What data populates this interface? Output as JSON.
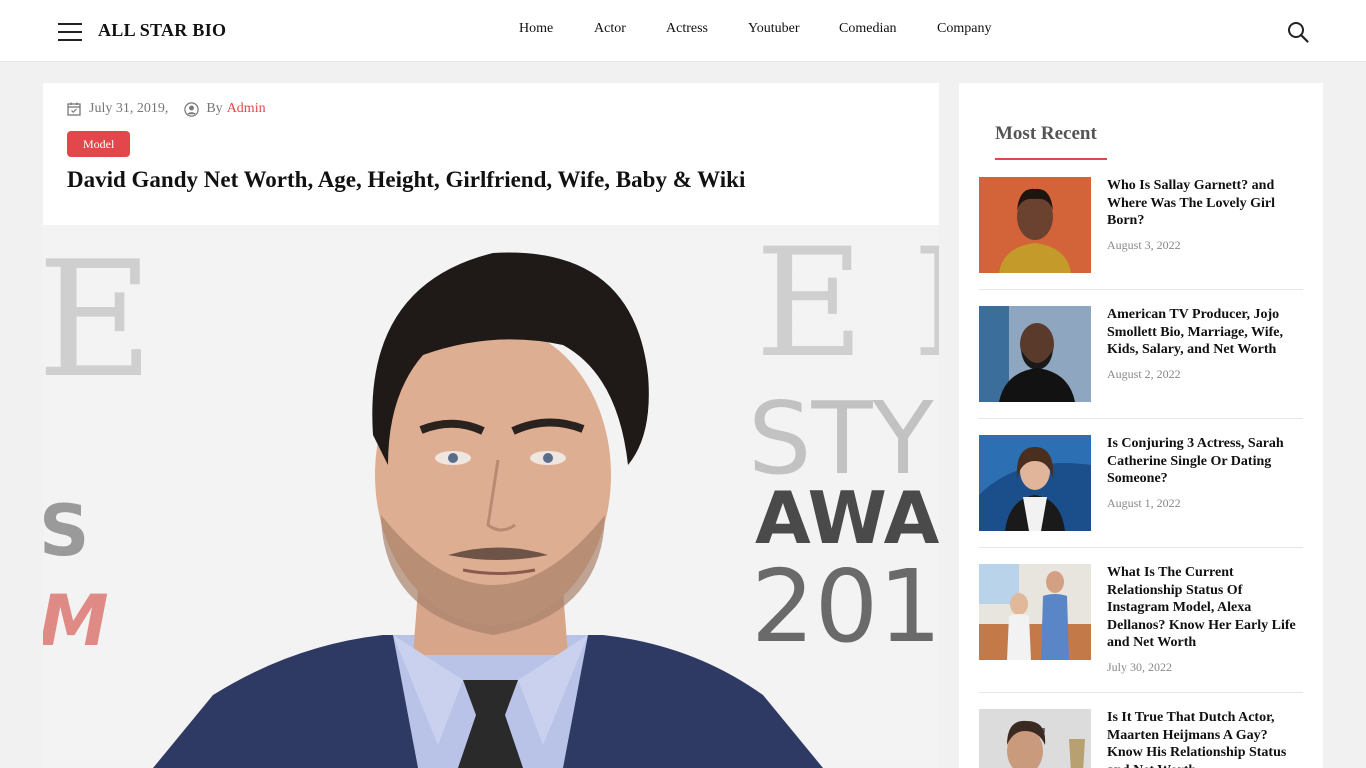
{
  "site": {
    "logo": "ALL STAR BIO"
  },
  "nav": [
    {
      "label": "Home"
    },
    {
      "label": "Actor"
    },
    {
      "label": "Actress"
    },
    {
      "label": "Youtuber"
    },
    {
      "label": "Comedian"
    },
    {
      "label": "Company"
    }
  ],
  "article": {
    "date": "July 31, 2019,",
    "by_label": "By",
    "author": "Admin",
    "category": "Model",
    "title": "David Gandy Net Worth, Age, Height, Girlfriend, Wife, Baby & Wiki",
    "hero_backdrop": {
      "left_letters": "E",
      "left_text": "S",
      "left_m": "M",
      "right_letters": "E L",
      "right_sty": "STY",
      "right_awa": "AWA",
      "right_year": "201"
    }
  },
  "sidebar": {
    "heading": "Most Recent",
    "posts": [
      {
        "title": "Who Is Sallay Garnett? and Where Was The Lovely Girl Born?",
        "date": "August 3, 2022"
      },
      {
        "title": "American TV Producer, Jojo Smollett Bio, Marriage, Wife, Kids, Salary, and Net Worth",
        "date": "August 2, 2022"
      },
      {
        "title": "Is Conjuring 3 Actress, Sarah Catherine Single Or Dating Someone?",
        "date": "August 1, 2022"
      },
      {
        "title": "What Is The Current Relationship Status Of Instagram Model, Alexa Dellanos? Know Her Early Life and Net Worth",
        "date": "July 30, 2022"
      },
      {
        "title": "Is It True That Dutch Actor, Maarten Heijmans A Gay? Know His Relationship Status and Net Worth",
        "date": ""
      }
    ]
  },
  "colors": {
    "accent": "#e2474b",
    "header_bg": "#ffffff",
    "page_bg": "#f1f1f1"
  },
  "icons": {
    "menu": "hamburger-icon",
    "search": "search-icon",
    "date": "calendar-icon",
    "author": "user-icon"
  }
}
